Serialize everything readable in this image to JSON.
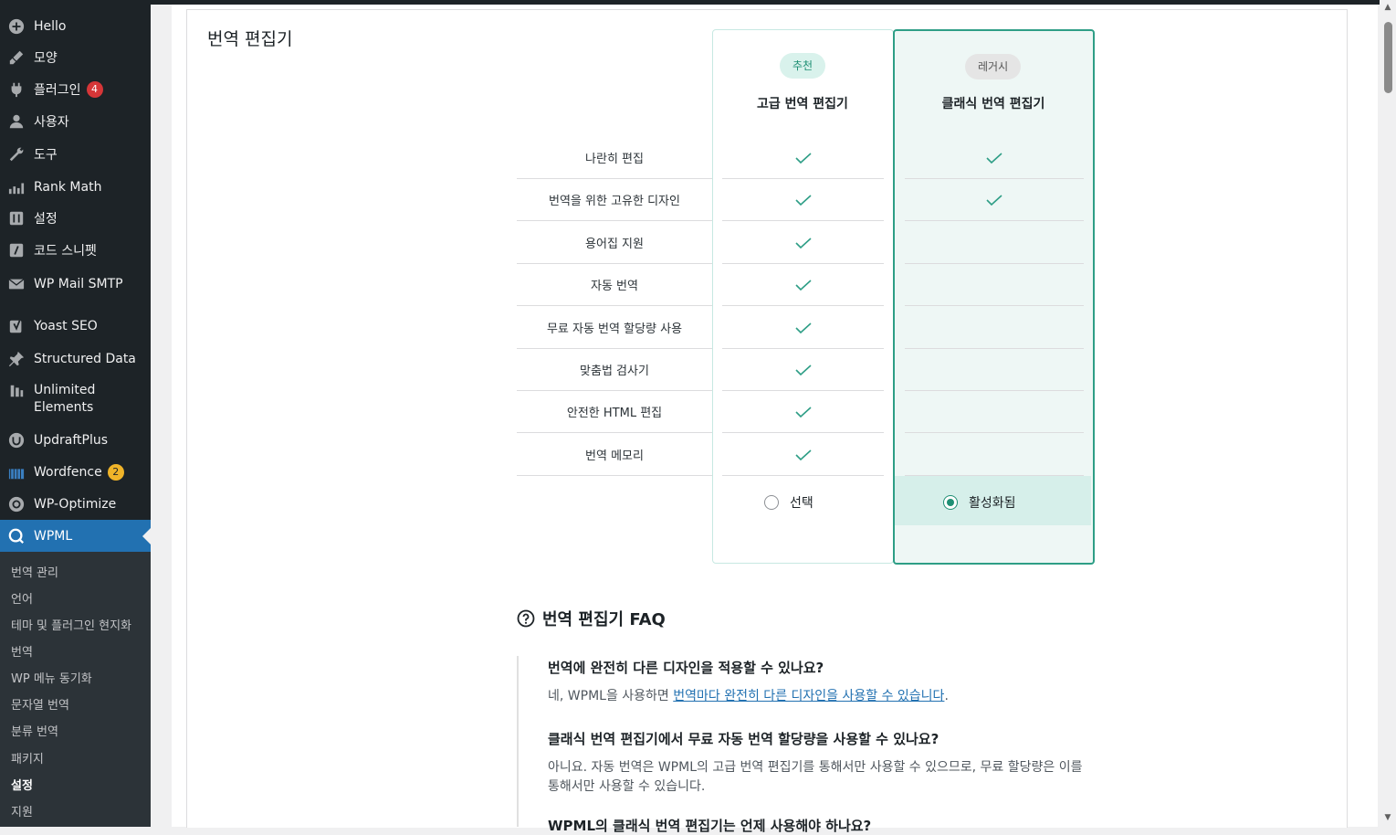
{
  "sidebar": {
    "items": [
      {
        "label": "Hello",
        "icon": "plus-circle-icon"
      },
      {
        "label": "모양",
        "icon": "brush-icon"
      },
      {
        "label": "플러그인",
        "icon": "plugin-icon",
        "badge": "4"
      },
      {
        "label": "사용자",
        "icon": "user-icon"
      },
      {
        "label": "도구",
        "icon": "wrench-icon"
      },
      {
        "label": "Rank Math",
        "icon": "chart-icon"
      },
      {
        "label": "설정",
        "icon": "settings-icon"
      },
      {
        "label": "코드 스니펫",
        "icon": "code-icon"
      },
      {
        "label": "WP Mail SMTP",
        "icon": "mail-icon"
      },
      {
        "label": "Yoast SEO",
        "icon": "yoast-icon"
      },
      {
        "label": "Structured Data",
        "icon": "pin-icon"
      },
      {
        "label": "Unlimited Elements",
        "icon": "elements-icon"
      },
      {
        "label": "UpdraftPlus",
        "icon": "updraft-icon"
      },
      {
        "label": "Wordfence",
        "icon": "wordfence-icon",
        "badge": "2"
      },
      {
        "label": "WP-Optimize",
        "icon": "optimize-icon"
      },
      {
        "label": "WPML",
        "icon": "wpml-icon"
      }
    ],
    "submenu": [
      "번역 관리",
      "언어",
      "테마 및 플러그인 현지화",
      "번역",
      "WP 메뉴 동기화",
      "문자열 번역",
      "분류 번역",
      "패키지",
      "설정",
      "지원"
    ]
  },
  "section": {
    "title": "번역 편집기"
  },
  "comparison": {
    "advanced": {
      "tag": "추천",
      "title": "고급 번역 편집기",
      "select_label": "선택"
    },
    "classic": {
      "tag": "레거시",
      "title": "클래식 번역 편집기",
      "select_label": "활성화됨"
    },
    "features": [
      {
        "label": "나란히 편집",
        "advanced": true,
        "classic": true
      },
      {
        "label": "번역을 위한 고유한 디자인",
        "advanced": true,
        "classic": true
      },
      {
        "label": "용어집 지원",
        "advanced": true,
        "classic": false
      },
      {
        "label": "자동 번역",
        "advanced": true,
        "classic": false
      },
      {
        "label": "무료 자동 번역 할당량 사용",
        "advanced": true,
        "classic": false
      },
      {
        "label": "맞춤법 검사기",
        "advanced": true,
        "classic": false
      },
      {
        "label": "안전한 HTML 편집",
        "advanced": true,
        "classic": false
      },
      {
        "label": "번역 메모리",
        "advanced": true,
        "classic": false
      }
    ]
  },
  "faq": {
    "title": "번역 편집기 FAQ",
    "items": [
      {
        "q": "번역에 완전히 다른 디자인을 적용할 수 있나요?",
        "a_prefix": "네, WPML을 사용하면 ",
        "a_link": "번역마다 완전히 다른 디자인을 사용할 수 있습니다",
        "a_suffix": "."
      },
      {
        "q": "클래식 번역 편집기에서 무료 자동 번역 할당량을 사용할 수 있나요?",
        "a": "아니요. 자동 번역은 WPML의 고급 번역 편집기를 통해서만 사용할 수 있으므로, 무료 할당량은 이를 통해서만 사용할 수 있습니다."
      },
      {
        "q": "WPML의 클래식 번역 편집기는 언제 사용해야 하나요?"
      }
    ]
  },
  "colors": {
    "accent": "#2e9e86",
    "wp_blue": "#2271b1",
    "sidebar_bg": "#1d2327"
  }
}
